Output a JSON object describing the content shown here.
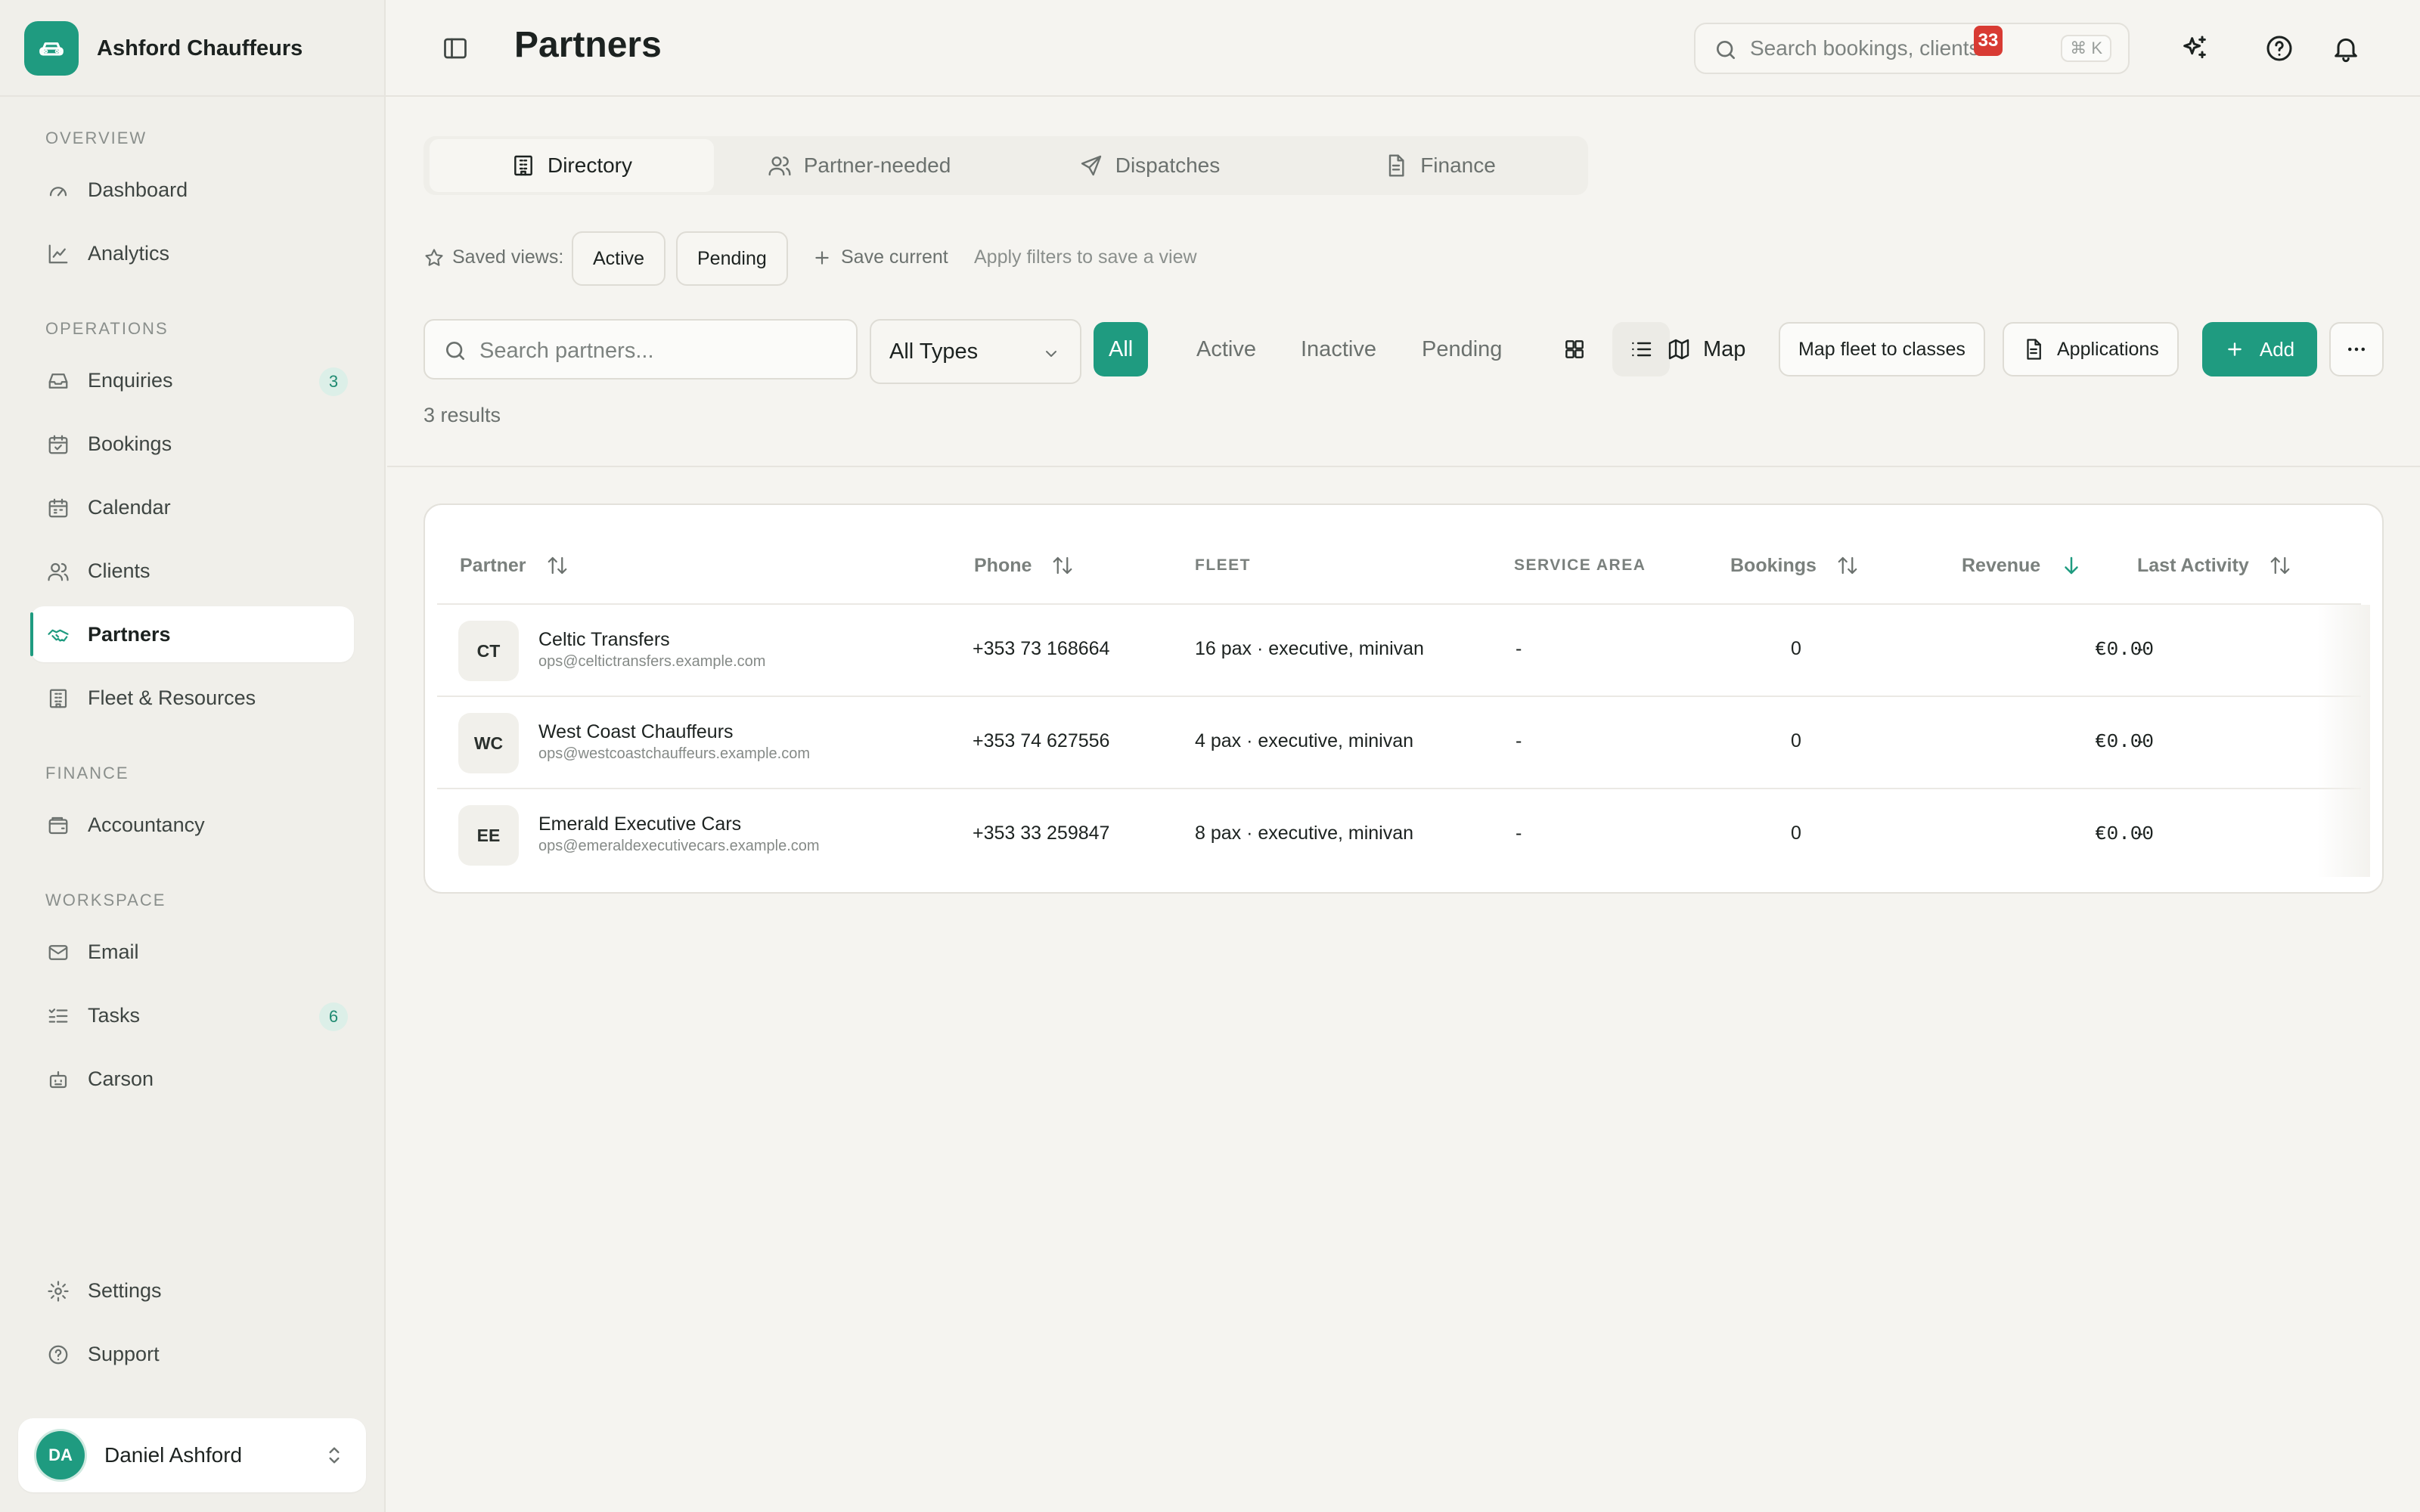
{
  "brand": {
    "name": "Ashford Chauffeurs"
  },
  "sidebar": {
    "sections": [
      {
        "label": "OVERVIEW"
      },
      {
        "label": "OPERATIONS"
      },
      {
        "label": "FINANCE"
      },
      {
        "label": "WORKSPACE"
      }
    ],
    "items": [
      {
        "label": "Dashboard",
        "icon": "gauge-icon"
      },
      {
        "label": "Analytics",
        "icon": "line-chart-icon"
      },
      {
        "label": "Enquiries",
        "icon": "inbox-icon",
        "badge": "3"
      },
      {
        "label": "Bookings",
        "icon": "calendar-check-icon"
      },
      {
        "label": "Calendar",
        "icon": "calendar-icon"
      },
      {
        "label": "Clients",
        "icon": "users-icon"
      },
      {
        "label": "Partners",
        "icon": "handshake-icon",
        "active": true
      },
      {
        "label": "Fleet & Resources",
        "icon": "building-icon"
      },
      {
        "label": "Accountancy",
        "icon": "wallet-icon"
      },
      {
        "label": "Email",
        "icon": "mail-icon"
      },
      {
        "label": "Tasks",
        "icon": "list-checks-icon",
        "badge": "6"
      },
      {
        "label": "Carson",
        "icon": "bot-icon"
      },
      {
        "label": "Settings",
        "icon": "gear-icon"
      },
      {
        "label": "Support",
        "icon": "help-circle-icon"
      }
    ],
    "user": {
      "initials": "DA",
      "name": "Daniel Ashford"
    }
  },
  "header": {
    "title": "Partners",
    "search_placeholder": "Search bookings, clients...",
    "shortcut": "⌘ K",
    "notification_count": "33"
  },
  "tabs": [
    {
      "label": "Directory",
      "icon": "building-icon",
      "active": true
    },
    {
      "label": "Partner-needed",
      "icon": "users-icon"
    },
    {
      "label": "Dispatches",
      "icon": "send-icon"
    },
    {
      "label": "Finance",
      "icon": "document-icon"
    }
  ],
  "saved_views": {
    "label": "Saved views:",
    "views": [
      "Active",
      "Pending"
    ],
    "save_label": "Save current",
    "hint": "Apply filters to save a view"
  },
  "filters": {
    "search_placeholder": "Search partners...",
    "type_value": "All Types",
    "status_options": [
      "All",
      "Active",
      "Inactive",
      "Pending"
    ],
    "active_status": "All",
    "map_label": "Map",
    "map_fleet_label": "Map fleet to classes",
    "applications_label": "Applications",
    "add_label": "Add"
  },
  "results_label": "3 results",
  "table": {
    "columns": {
      "partner": "Partner",
      "phone": "Phone",
      "fleet": "FLEET",
      "service_area": "SERVICE AREA",
      "bookings": "Bookings",
      "revenue": "Revenue",
      "last_activity": "Last Activity"
    },
    "sorted_by": "Revenue",
    "rows": [
      {
        "initials": "CT",
        "name": "Celtic Transfers",
        "email": "ops@celtictransfers.example.com",
        "phone": "+353 73 168664",
        "fleet": "16 pax · executive, minivan",
        "service_area": "-",
        "bookings": "0",
        "revenue": "€0.00",
        "last_activity": "-"
      },
      {
        "initials": "WC",
        "name": "West Coast Chauffeurs",
        "email": "ops@westcoastchauffeurs.example.com",
        "phone": "+353 74 627556",
        "fleet": "4 pax · executive, minivan",
        "service_area": "-",
        "bookings": "0",
        "revenue": "€0.00",
        "last_activity": "-"
      },
      {
        "initials": "EE",
        "name": "Emerald Executive Cars",
        "email": "ops@emeraldexecutivecars.example.com",
        "phone": "+353 33 259847",
        "fleet": "8 pax · executive, minivan",
        "service_area": "-",
        "bookings": "0",
        "revenue": "€0.00",
        "last_activity": "-"
      }
    ]
  },
  "colors": {
    "accent": "#1f9b80",
    "badge_red": "#d83b33",
    "background": "#f5f4f0"
  }
}
